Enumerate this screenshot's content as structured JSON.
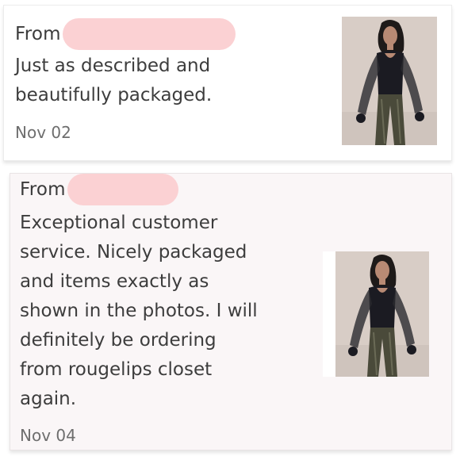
{
  "reviews": [
    {
      "from_label": "From",
      "text": "Just as described and\nbeautifully packaged.",
      "date": "Nov 02",
      "image_icon": "product-photo-model-sheer-sleeve-top"
    },
    {
      "from_label": "From",
      "text": "Exceptional customer\nservice. Nicely packaged\nand items exactly as\nshown in the photos. I will\ndefinitely be ordering\nfrom rougelips closet\nagain.",
      "date": "Nov 04",
      "image_icon": "product-photo-model-sheer-sleeve-top"
    }
  ],
  "colors": {
    "redaction": "#fbd1d3",
    "text": "#3d3d3d",
    "date": "#6e6e6e",
    "card2_bg": "#faf6f7"
  }
}
